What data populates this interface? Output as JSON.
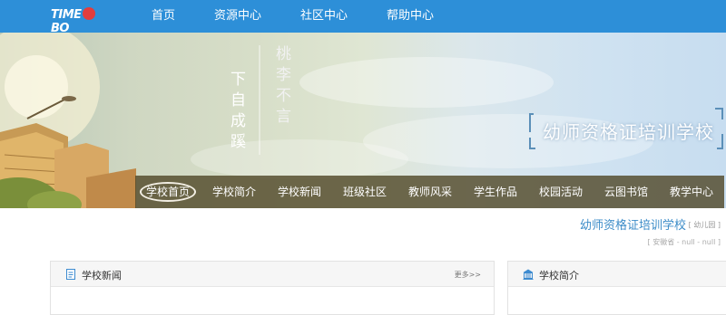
{
  "site": {
    "logo_text_left": "TIME",
    "logo_text_right": "BO",
    "nav": [
      "首页",
      "资源中心",
      "社区中心",
      "帮助中心"
    ]
  },
  "banner": {
    "poem_left": "下自成蹊",
    "poem_right": "桃李不言",
    "school_title": "幼师资格证培训学校"
  },
  "school_nav": {
    "items": [
      "学校首页",
      "学校简介",
      "学校新闻",
      "班级社区",
      "教师风采",
      "学生作品",
      "校园活动",
      "云图书馆",
      "教学中心"
    ],
    "active_index": 0
  },
  "school_info": {
    "name": "幼师资格证培训学校",
    "type": "[ 幼儿园 ]",
    "location": "[ 安徽省 - null - null ]"
  },
  "panels": {
    "news": {
      "title": "学校新闻",
      "more": "更多>>"
    },
    "intro": {
      "title": "学校简介"
    }
  },
  "colors": {
    "topbar": "#2d8fd8",
    "school_nav_bg": "#52492a",
    "info_name": "#3c8cc8"
  },
  "icons": {
    "news": "document-icon",
    "intro": "building-icon"
  }
}
